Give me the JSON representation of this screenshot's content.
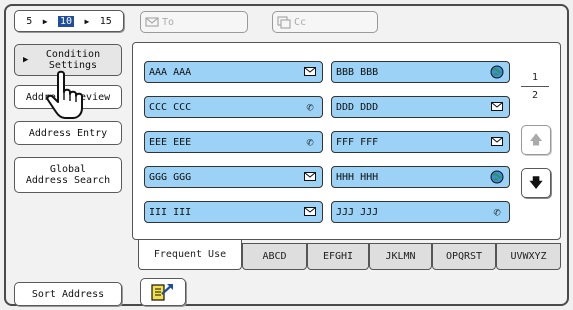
{
  "nav": {
    "pages": [
      "5",
      "10",
      "15"
    ]
  },
  "recipients": {
    "to_label": "To",
    "cc_label": "Cc"
  },
  "side_buttons": {
    "condition_settings": "Condition\nSettings",
    "address_review": "Address Review",
    "address_entry": "Address Entry",
    "global_search": "Global\nAddress Search",
    "sort_address": "Sort Address"
  },
  "addresses": [
    {
      "name": "AAA AAA",
      "icon": "email-icon"
    },
    {
      "name": "BBB BBB",
      "icon": "globe-icon"
    },
    {
      "name": "CCC CCC",
      "icon": "phone-icon"
    },
    {
      "name": "DDD DDD",
      "icon": "email-icon"
    },
    {
      "name": "EEE EEE",
      "icon": "phone-icon"
    },
    {
      "name": "FFF FFF",
      "icon": "email-icon"
    },
    {
      "name": "GGG GGG",
      "icon": "email-icon"
    },
    {
      "name": "HHH HHH",
      "icon": "globe-icon"
    },
    {
      "name": "III III",
      "icon": "email-icon"
    },
    {
      "name": "JJJ JJJ",
      "icon": "phone-icon"
    }
  ],
  "pagination": {
    "current": "1",
    "total": "2"
  },
  "tabs": [
    "Frequent Use",
    "ABCD",
    "EFGHI",
    "JKLMN",
    "OPQRST",
    "UVWXYZ"
  ],
  "colors": {
    "address_fill": "#9bd2f5",
    "accent_blue": "#1f4e9e",
    "highlight_yellow": "#f3e04a"
  }
}
